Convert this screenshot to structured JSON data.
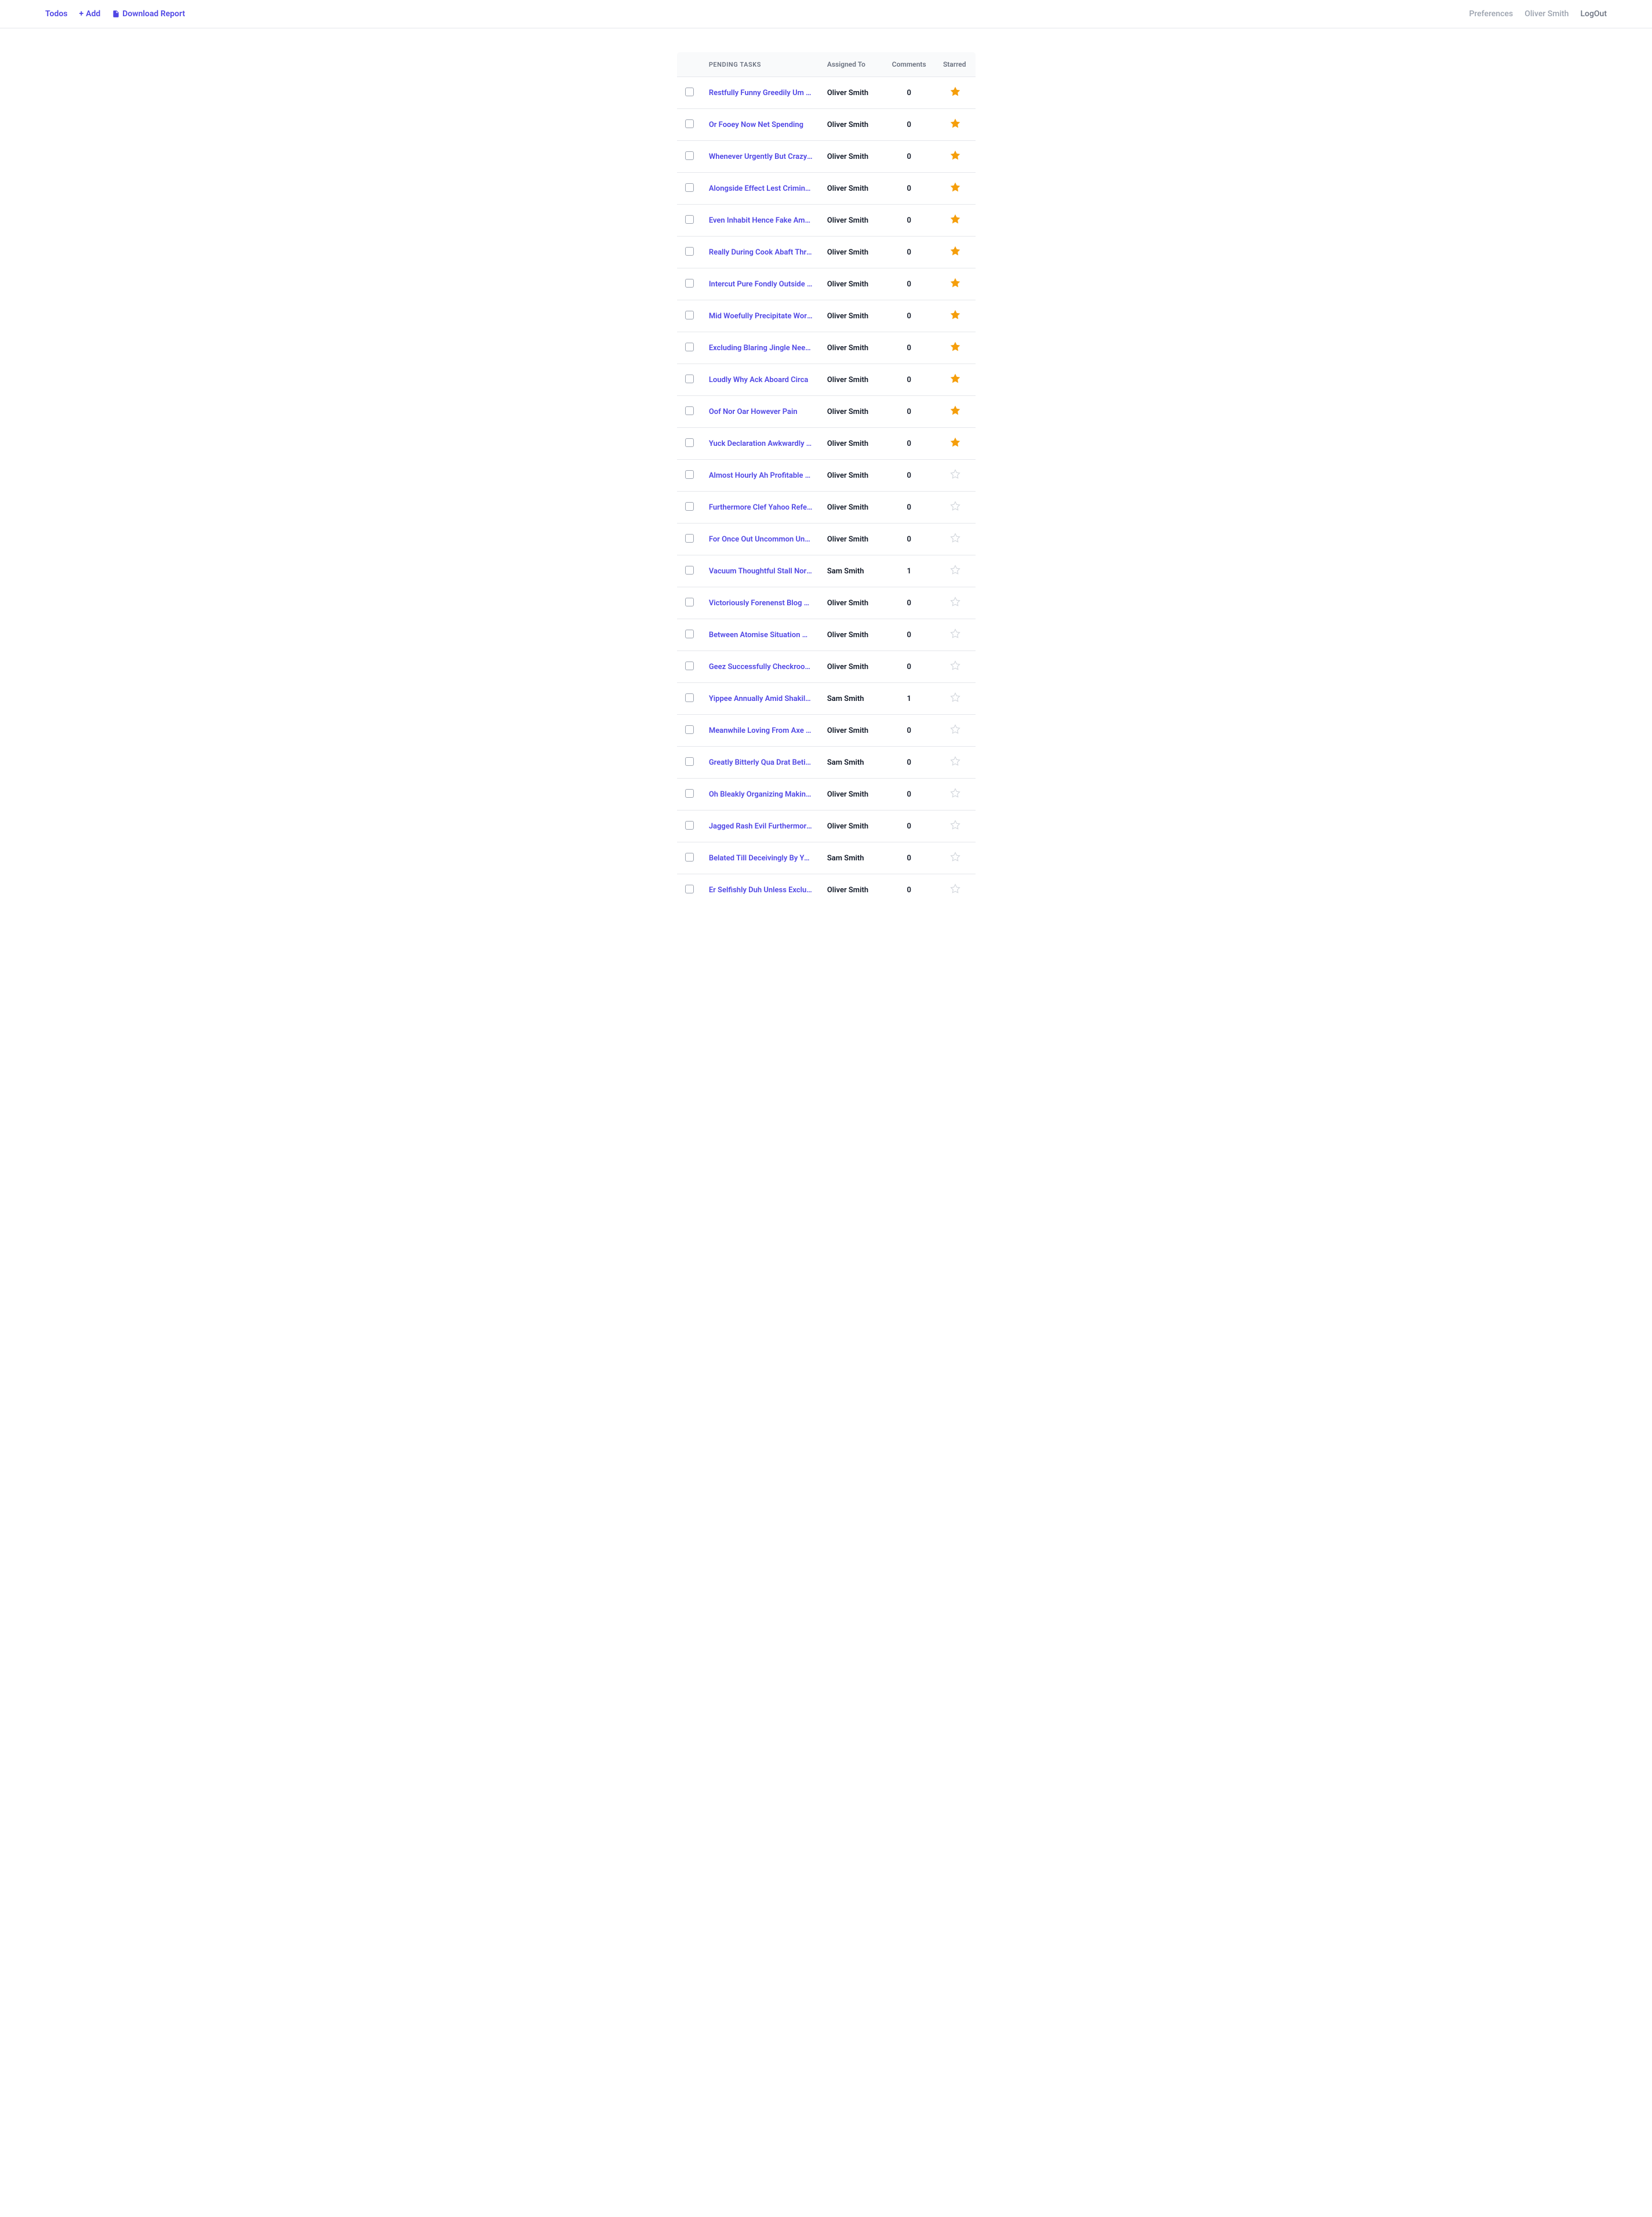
{
  "nav": {
    "todos": "Todos",
    "add": "Add",
    "download": "Download Report",
    "preferences": "Preferences",
    "user": "Oliver Smith",
    "logout": "LogOut"
  },
  "table": {
    "headers": {
      "tasks": "Pending Tasks",
      "assigned": "Assigned To",
      "comments": "Comments",
      "starred": "Starred"
    },
    "rows": [
      {
        "title": "Restfully Funny Greedily Um Crossly",
        "assigned": "Oliver Smith",
        "comments": "0",
        "starred": true
      },
      {
        "title": "Or Fooey Now Net Spending",
        "assigned": "Oliver Smith",
        "comments": "0",
        "starred": true
      },
      {
        "title": "Whenever Urgently But Crazy Diphthong",
        "assigned": "Oliver Smith",
        "comments": "0",
        "starred": true
      },
      {
        "title": "Alongside Effect Lest Criminal Which",
        "assigned": "Oliver Smith",
        "comments": "0",
        "starred": true
      },
      {
        "title": "Even Inhabit Hence Fake Among",
        "assigned": "Oliver Smith",
        "comments": "0",
        "starred": true
      },
      {
        "title": "Really During Cook Abaft Throughout",
        "assigned": "Oliver Smith",
        "comments": "0",
        "starred": true
      },
      {
        "title": "Intercut Pure Fondly Outside Jacket",
        "assigned": "Oliver Smith",
        "comments": "0",
        "starred": true
      },
      {
        "title": "Mid Woefully Precipitate Worth Confusion",
        "assigned": "Oliver Smith",
        "comments": "0",
        "starred": true
      },
      {
        "title": "Excluding Blaring Jingle Needily Green",
        "assigned": "Oliver Smith",
        "comments": "0",
        "starred": true
      },
      {
        "title": "Loudly Why Ack Aboard Circa",
        "assigned": "Oliver Smith",
        "comments": "0",
        "starred": true
      },
      {
        "title": "Oof Nor Oar However Pain",
        "assigned": "Oliver Smith",
        "comments": "0",
        "starred": true
      },
      {
        "title": "Yuck Declaration Awkwardly Aboard After",
        "assigned": "Oliver Smith",
        "comments": "0",
        "starred": true
      },
      {
        "title": "Almost Hourly Ah Profitable Lightheartedly",
        "assigned": "Oliver Smith",
        "comments": "0",
        "starred": false
      },
      {
        "title": "Furthermore Clef Yahoo Reference Though",
        "assigned": "Oliver Smith",
        "comments": "0",
        "starred": false
      },
      {
        "title": "For Once Out Uncommon Unaccountably",
        "assigned": "Oliver Smith",
        "comments": "0",
        "starred": false
      },
      {
        "title": "Vacuum Thoughtful Stall Nor Toga",
        "assigned": "Sam Smith",
        "comments": "1",
        "starred": false
      },
      {
        "title": "Victoriously Forenenst Blog Questionably",
        "assigned": "Oliver Smith",
        "comments": "0",
        "starred": false
      },
      {
        "title": "Between Atomise Situation Wrench Past",
        "assigned": "Oliver Smith",
        "comments": "0",
        "starred": false
      },
      {
        "title": "Geez Successfully Checkroom Really",
        "assigned": "Oliver Smith",
        "comments": "0",
        "starred": false
      },
      {
        "title": "Yippee Annually Amid Shakily Organic",
        "assigned": "Sam Smith",
        "comments": "1",
        "starred": false
      },
      {
        "title": "Meanwhile Loving From Axe Rudely",
        "assigned": "Oliver Smith",
        "comments": "0",
        "starred": false
      },
      {
        "title": "Greatly Bitterly Qua Drat Betide",
        "assigned": "Sam Smith",
        "comments": "0",
        "starred": false
      },
      {
        "title": "Oh Bleakly Organizing Making Unroll",
        "assigned": "Oliver Smith",
        "comments": "0",
        "starred": false
      },
      {
        "title": "Jagged Rash Evil Furthermore After",
        "assigned": "Oliver Smith",
        "comments": "0",
        "starred": false
      },
      {
        "title": "Belated Till Deceivingly By Yesterday",
        "assigned": "Sam Smith",
        "comments": "0",
        "starred": false
      },
      {
        "title": "Er Selfishly Duh Unless Excluding",
        "assigned": "Oliver Smith",
        "comments": "0",
        "starred": false
      }
    ]
  }
}
